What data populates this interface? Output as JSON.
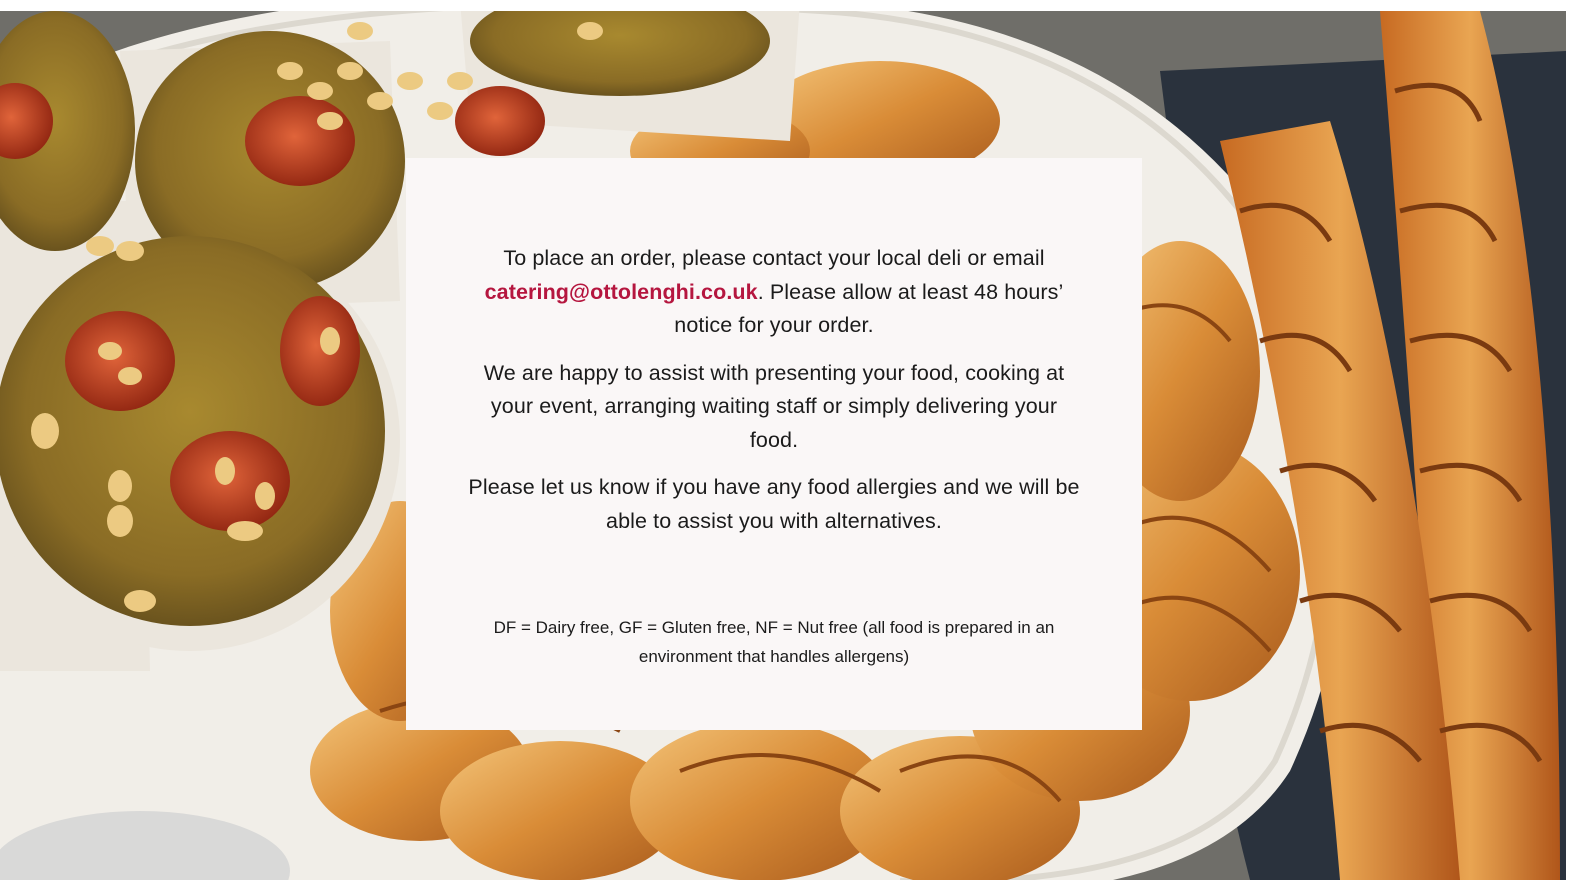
{
  "hero_image": {
    "icon": "bakery-pastries-photo",
    "colors": {
      "croissant": "#d88f3c",
      "croissant_light": "#f1bd6b",
      "muffin": "#9a7a2c",
      "muffin_dark": "#6e5620",
      "tomato": "#b8381c",
      "pine_nut": "#e9c77e",
      "plate": "#f3f0ea",
      "tray": "#2b3440",
      "table": "#6b6a66"
    }
  },
  "card": {
    "background": "#faf7f7",
    "paragraph1_before": "To place an order, please contact your local deli or email",
    "email": "catering@ottolenghi.co.uk",
    "paragraph1_after": ". Please allow at least 48 hours’ notice for your order.",
    "paragraph2": "We are happy to assist with presenting your food, cooking at your event, arranging waiting staff or simply delivering your food.",
    "paragraph3": "Please let us know if you have any food allergies and we will be able to assist you with alternatives.",
    "allergen_note": "DF = Dairy free, GF = Gluten free, NF = Nut free (all food is prepared in an environment that handles allergens)"
  },
  "colors": {
    "link": "#b5163f",
    "text": "#1b1b1b"
  }
}
